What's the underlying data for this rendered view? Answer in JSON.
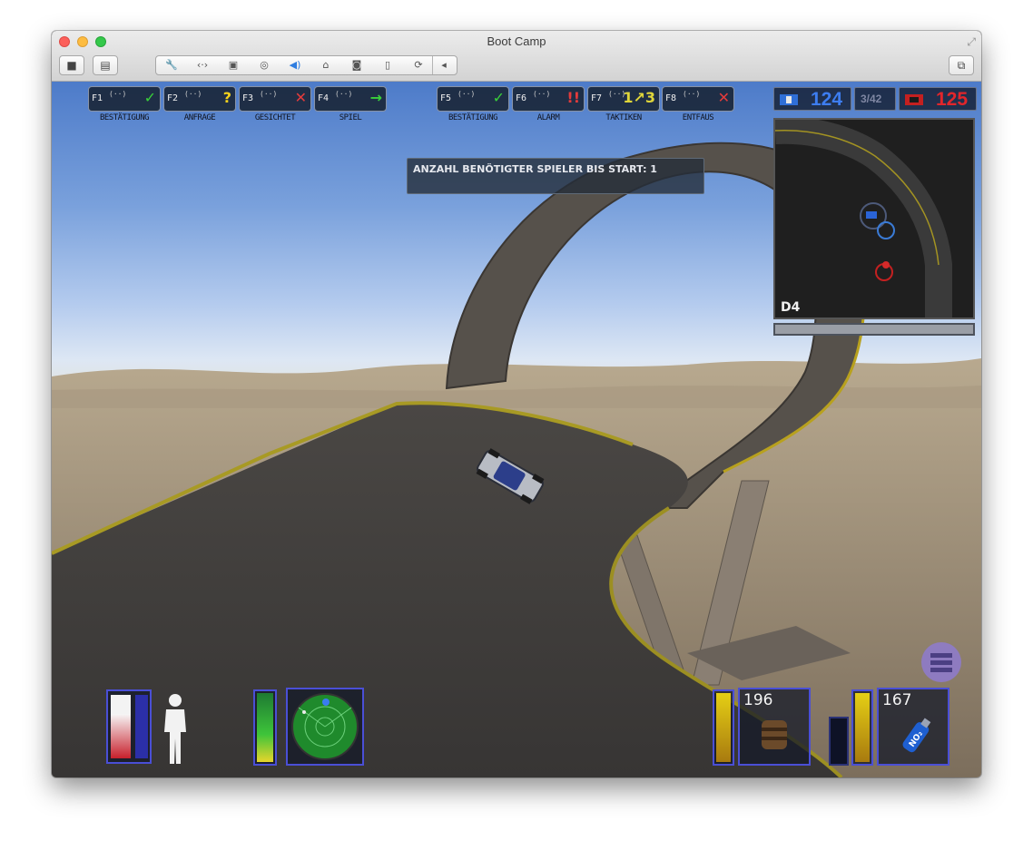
{
  "window": {
    "title": "Boot Camp"
  },
  "toolbar": {
    "items": [
      "wrench-icon",
      "resize-arrows-icon",
      "disk-icon",
      "cd-icon",
      "volume-icon",
      "usb-icon",
      "camera-icon",
      "mouse-icon",
      "sync-icon",
      "collapse-icon"
    ]
  },
  "radio_menu": [
    {
      "key": "F1",
      "label": "BESTÄTIGUNG",
      "icon": "✓",
      "color": "#39d03a"
    },
    {
      "key": "F2",
      "label": "ANFRAGE",
      "icon": "?",
      "color": "#f4d21c"
    },
    {
      "key": "F3",
      "label": "GESICHTET",
      "icon": "✕",
      "color": "#e43b3b"
    },
    {
      "key": "F4",
      "label": "SPIEL",
      "icon": "→",
      "color": "#39d03a"
    },
    {
      "key": "F5",
      "label": "BESTÄTIGUNG",
      "icon": "✓",
      "color": "#39d03a"
    },
    {
      "key": "F6",
      "label": "ALARM",
      "icon": "!!",
      "color": "#e43b3b"
    },
    {
      "key": "F7",
      "label": "TAKTIKEN",
      "icon": "1↗3",
      "color": "#e0d63a"
    },
    {
      "key": "F8",
      "label": "ENTFAUS",
      "icon": "✕",
      "color": "#e43b3b"
    }
  ],
  "message": "ANZAHL BENÖTIGTER SPIELER BIS START: 1",
  "score": {
    "blue": "124",
    "mid": "3/42",
    "red": "125",
    "blue_color": "#3d7df0",
    "red_color": "#e2262b"
  },
  "minimap": {
    "grid": "D4"
  },
  "hud": {
    "ammo_count": "196",
    "nitro_count": "167",
    "nitro_label": "NO₂",
    "health_level": 0.7
  }
}
